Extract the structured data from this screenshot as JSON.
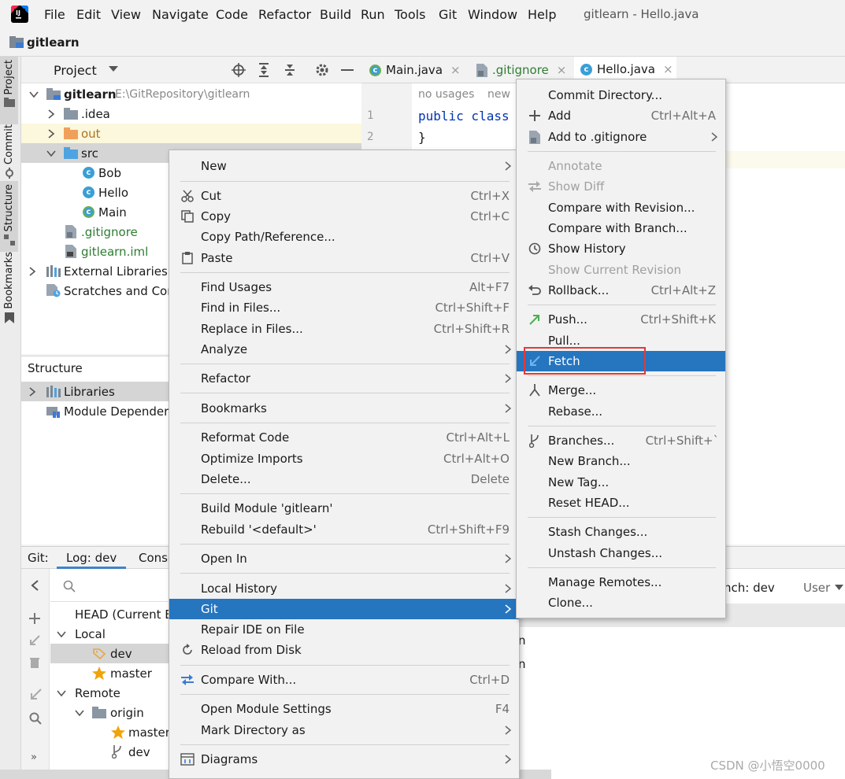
{
  "window_title": "gitlearn - Hello.java",
  "menu_bar": [
    "File",
    "Edit",
    "View",
    "Navigate",
    "Code",
    "Refactor",
    "Build",
    "Run",
    "Tools",
    "Git",
    "Window",
    "Help"
  ],
  "breadcrumb": "gitlearn",
  "left_stripe": {
    "project": "Project",
    "commit": "Commit",
    "structure": "Structure",
    "bookmarks": "Bookmarks"
  },
  "project_panel": {
    "title": "Project",
    "tree": {
      "root": "gitlearn",
      "root_path": "E:\\GitRepository\\gitlearn",
      "idea": ".idea",
      "out": "out",
      "src": "src",
      "bob": "Bob",
      "hello": "Hello",
      "main": "Main",
      "gitignore": ".gitignore",
      "iml": "gitlearn.iml",
      "ext_libs": "External Libraries",
      "scratches": "Scratches and Con"
    }
  },
  "structure_panel": {
    "title": "Structure",
    "libraries": "Libraries",
    "module_deps": "Module Depender"
  },
  "editor": {
    "tabs": [
      "Main.java",
      ".gitignore",
      "Hello.java"
    ],
    "inlay": "no usages",
    "inlay2": "new",
    "line1": "1",
    "line2": "2",
    "code1": "public class",
    "code2": "}"
  },
  "git_panel": {
    "tab_git": "Git:",
    "tab_log": "Log: dev",
    "tab_console": "Conso",
    "branch_filter": "nch: dev",
    "user_filter": "User",
    "head": "HEAD (Current B",
    "local": "Local",
    "dev": "dev",
    "master": "master",
    "remote": "Remote",
    "origin": "origin",
    "origin_master": "master",
    "origin_dev": "dev",
    "frag1": "n",
    "frag2": "n",
    "more": "»"
  },
  "context_menu": {
    "new": "New",
    "cut": "Cut",
    "cut_sc": "Ctrl+X",
    "copy": "Copy",
    "copy_sc": "Ctrl+C",
    "copy_path": "Copy Path/Reference...",
    "paste": "Paste",
    "paste_sc": "Ctrl+V",
    "find_usages": "Find Usages",
    "find_usages_sc": "Alt+F7",
    "find_files": "Find in Files...",
    "find_files_sc": "Ctrl+Shift+F",
    "replace_files": "Replace in Files...",
    "replace_files_sc": "Ctrl+Shift+R",
    "analyze": "Analyze",
    "refactor": "Refactor",
    "bookmarks": "Bookmarks",
    "reformat": "Reformat Code",
    "reformat_sc": "Ctrl+Alt+L",
    "optimize": "Optimize Imports",
    "optimize_sc": "Ctrl+Alt+O",
    "delete": "Delete...",
    "delete_sc": "Delete",
    "build_module": "Build Module 'gitlearn'",
    "rebuild": "Rebuild '<default>'",
    "rebuild_sc": "Ctrl+Shift+F9",
    "open_in": "Open In",
    "local_history": "Local History",
    "git": "Git",
    "repair": "Repair IDE on File",
    "reload": "Reload from Disk",
    "compare": "Compare With...",
    "compare_sc": "Ctrl+D",
    "module_settings": "Open Module Settings",
    "module_settings_sc": "F4",
    "mark_dir": "Mark Directory as",
    "diagrams": "Diagrams"
  },
  "git_menu": {
    "commit_dir": "Commit Directory...",
    "add": "Add",
    "add_sc": "Ctrl+Alt+A",
    "add_gitignore": "Add to .gitignore",
    "annotate": "Annotate",
    "show_diff": "Show Diff",
    "compare_rev": "Compare with Revision...",
    "compare_branch": "Compare with Branch...",
    "show_history": "Show History",
    "show_current_rev": "Show Current Revision",
    "rollback": "Rollback...",
    "rollback_sc": "Ctrl+Alt+Z",
    "push": "Push...",
    "push_sc": "Ctrl+Shift+K",
    "pull": "Pull...",
    "fetch": "Fetch",
    "merge": "Merge...",
    "rebase": "Rebase...",
    "branches": "Branches...",
    "branches_sc": "Ctrl+Shift+`",
    "new_branch": "New Branch...",
    "new_tag": "New Tag...",
    "reset_head": "Reset HEAD...",
    "stash": "Stash Changes...",
    "unstash": "Unstash Changes...",
    "manage_remotes": "Manage Remotes...",
    "clone": "Clone..."
  },
  "watermark": "CSDN @小悟空0000",
  "colors": {
    "selection": "#2675bf",
    "accent_green": "#2e7d32",
    "highlight_box": "#e53935"
  }
}
